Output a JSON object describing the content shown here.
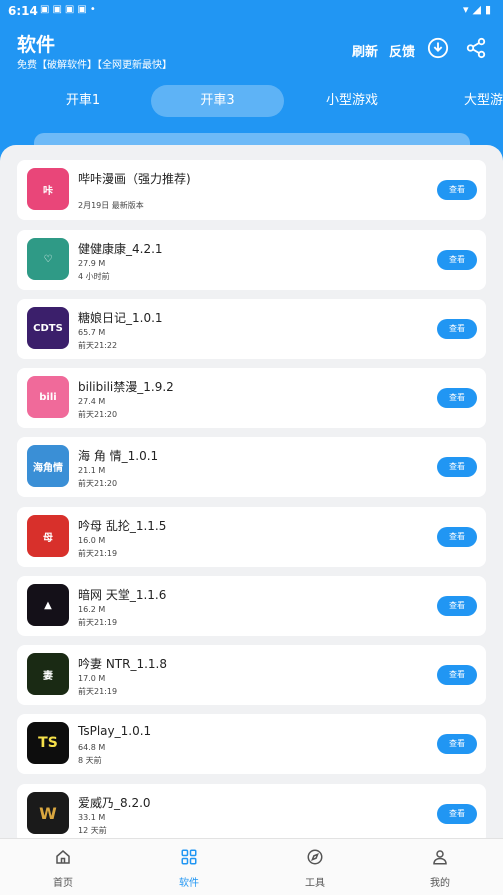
{
  "status_bar": {
    "time": "6:14",
    "notif_icons": [
      "paw-icon",
      "paw-icon",
      "paw-icon",
      "paw-icon",
      "dot"
    ],
    "right_icons": [
      "wifi-icon",
      "signal-icon",
      "battery-icon"
    ]
  },
  "header": {
    "title": "软件",
    "subtitle": "免费【破解软件】【全网更新最快】",
    "refresh_label": "刷新",
    "feedback_label": "反馈",
    "download_icon": "download-icon",
    "share_icon": "share-icon"
  },
  "tabs": [
    {
      "label": "开車1",
      "active": false
    },
    {
      "label": "开車3",
      "active": true
    },
    {
      "label": "小型游戏",
      "active": false
    },
    {
      "label": "大型游戏",
      "active": false
    }
  ],
  "apps": [
    {
      "name": "哔咔漫画（强力推荐)",
      "size": "",
      "date": "2月19日 最新版本",
      "button": "查看",
      "icon_color": "#e94679",
      "icon_text": "咔"
    },
    {
      "name": "健健康康_4.2.1",
      "size": "27.9 M",
      "date": "4 小时前",
      "button": "查看",
      "icon_color": "#2f9a86",
      "icon_text": "♡"
    },
    {
      "name": "糖娘日记_1.0.1",
      "size": "65.7 M",
      "date": "前天21:22",
      "button": "查看",
      "icon_color": "#3b1f6b",
      "icon_text": "CDTS"
    },
    {
      "name": "bilibili禁漫_1.9.2",
      "size": "27.4 M",
      "date": "前天21:20",
      "button": "查看",
      "icon_color": "#f06a9a",
      "icon_text": "bili"
    },
    {
      "name": "海 角 情_1.0.1",
      "size": "21.1 M",
      "date": "前天21:20",
      "button": "查看",
      "icon_color": "#3a8fd6",
      "icon_text": "海角情"
    },
    {
      "name": "吟母 乱抡_1.1.5",
      "size": "16.0 M",
      "date": "前天21:19",
      "button": "查看",
      "icon_color": "#d8302b",
      "icon_text": "母"
    },
    {
      "name": "暗网 天堂_1.1.6",
      "size": "16.2 M",
      "date": "前天21:19",
      "button": "查看",
      "icon_color": "#141018",
      "icon_text": "▲"
    },
    {
      "name": "吟妻 NTR_1.1.8",
      "size": "17.0 M",
      "date": "前天21:19",
      "button": "查看",
      "icon_color": "#1a2a14",
      "icon_text": "妻"
    },
    {
      "name": "TsPlay_1.0.1",
      "size": "64.8 M",
      "date": "8 天前",
      "button": "查看",
      "icon_color": "#0d0d0d",
      "icon_text": "TS"
    },
    {
      "name": "爱威乃_8.2.0",
      "size": "33.1 M",
      "date": "12 天前",
      "button": "查看",
      "icon_color": "#1a1a1a",
      "icon_text": "W"
    }
  ],
  "bottom_nav": [
    {
      "label": "首页",
      "icon": "home-icon",
      "active": false
    },
    {
      "label": "软件",
      "icon": "grid-icon",
      "active": true
    },
    {
      "label": "工具",
      "icon": "compass-icon",
      "active": false
    },
    {
      "label": "我的",
      "icon": "user-icon",
      "active": false
    }
  ],
  "colors": {
    "primary": "#2196f3",
    "background": "#f0f1f3"
  }
}
